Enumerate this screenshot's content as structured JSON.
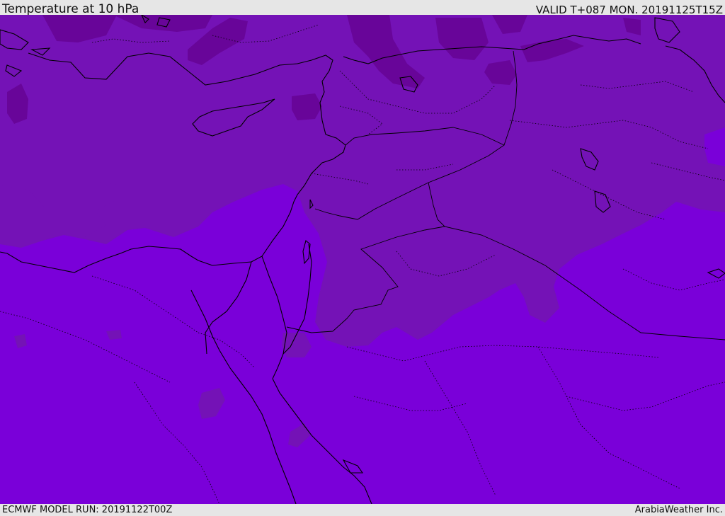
{
  "header": {
    "title": "Temperature at 10 hPa",
    "valid": "VALID T+087 MON. 20191125T15Z"
  },
  "footer": {
    "model_run": "ECMWF MODEL RUN: 20191122T00Z",
    "credit": "ArabiaWeather Inc."
  },
  "map": {
    "colors": {
      "base": "#7a00d9",
      "mid": "#7412b6",
      "dark": "#680599",
      "coast": "#000000",
      "border": "#000000"
    }
  }
}
